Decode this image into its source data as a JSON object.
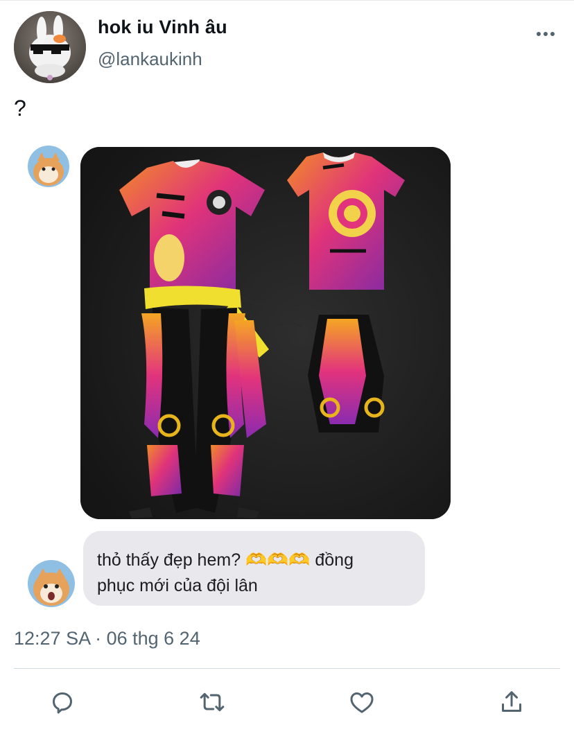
{
  "tweet": {
    "display_name": "hok iu Vinh âu",
    "handle": "@lankaukinh",
    "text": "?",
    "timestamp": "12:27 SA · 06 thg 6 24"
  },
  "chat": {
    "message_line1": "thỏ thấy đẹp hem? 🫶🫶🫶  đồng",
    "message_line2": "phục mới của đội lân"
  },
  "icons": {
    "more": "more-horizontal-icon",
    "reply": "reply-icon",
    "retweet": "retweet-icon",
    "like": "heart-icon",
    "share": "share-icon"
  },
  "colors": {
    "text_primary": "#0f1419",
    "text_secondary": "#536471",
    "bubble_bg": "#e9e9ed",
    "image_bg": "#1c1c1c",
    "uniform_accent": "#e8b41c"
  }
}
